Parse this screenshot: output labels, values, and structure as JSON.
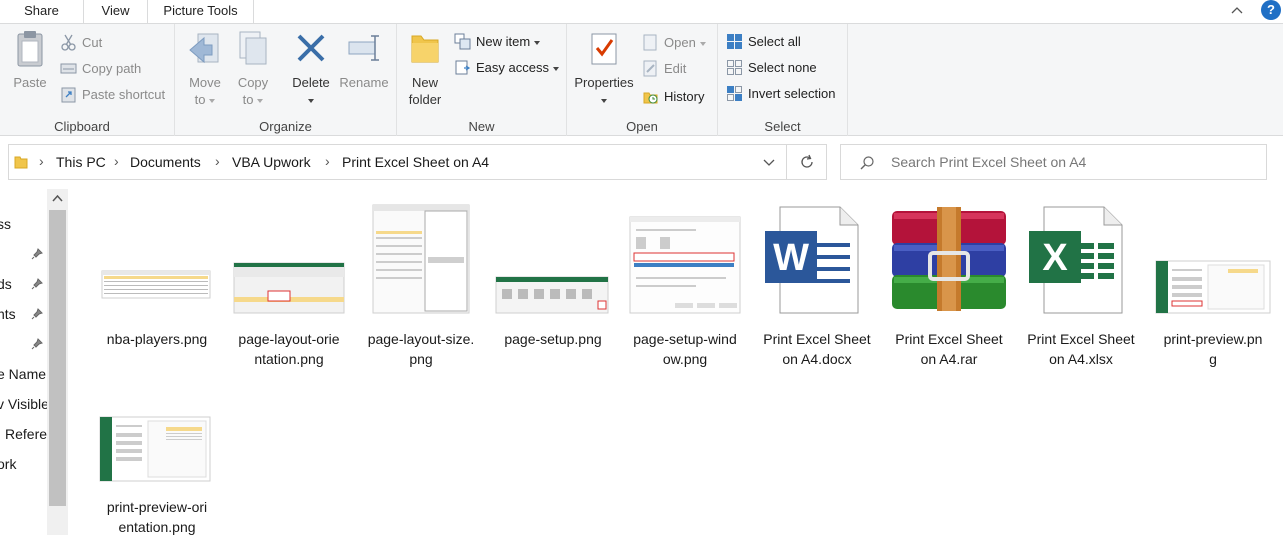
{
  "tabs": [
    {
      "label": "Share"
    },
    {
      "label": "View"
    },
    {
      "label": "Picture Tools"
    }
  ],
  "help_label": "?",
  "ribbon": {
    "clipboard": {
      "label": "Clipboard",
      "paste": "Paste",
      "cut": "Cut",
      "copy_path": "Copy path",
      "paste_shortcut": "Paste shortcut"
    },
    "organize": {
      "label": "Organize",
      "move_to_1": "Move",
      "move_to_2": "to",
      "copy_to_1": "Copy",
      "copy_to_2": "to",
      "delete": "Delete",
      "rename": "Rename"
    },
    "new": {
      "label": "New",
      "new_folder_1": "New",
      "new_folder_2": "folder",
      "new_item": "New item",
      "easy_access": "Easy access"
    },
    "open": {
      "label": "Open",
      "properties": "Properties",
      "open": "Open",
      "edit": "Edit",
      "history": "History"
    },
    "select": {
      "label": "Select",
      "select_all": "Select all",
      "select_none": "Select none",
      "invert_selection": "Invert selection"
    }
  },
  "address": {
    "crumbs": [
      "This PC",
      "Documents",
      "VBA Upwork",
      "Print Excel Sheet on A4"
    ],
    "search_placeholder": "Search Print Excel Sheet on A4"
  },
  "nav": {
    "items": [
      "ss",
      "ds",
      "nts",
      "",
      "e Name",
      "v Visible",
      "Refere",
      "ork"
    ]
  },
  "files": [
    {
      "name_1": "nba-players.png",
      "name_2": ""
    },
    {
      "name_1": "page-layout-orie",
      "name_2": "ntation.png"
    },
    {
      "name_1": "page-layout-size.",
      "name_2": "png"
    },
    {
      "name_1": "page-setup.png",
      "name_2": ""
    },
    {
      "name_1": "page-setup-wind",
      "name_2": "ow.png"
    },
    {
      "name_1": "Print Excel Sheet",
      "name_2": "on A4.docx"
    },
    {
      "name_1": "Print Excel Sheet",
      "name_2": "on A4.rar"
    },
    {
      "name_1": "Print Excel Sheet",
      "name_2": "on A4.xlsx"
    },
    {
      "name_1": "print-preview.pn",
      "name_2": "g"
    },
    {
      "name_1": "print-preview-ori",
      "name_2": "entation.png"
    }
  ]
}
